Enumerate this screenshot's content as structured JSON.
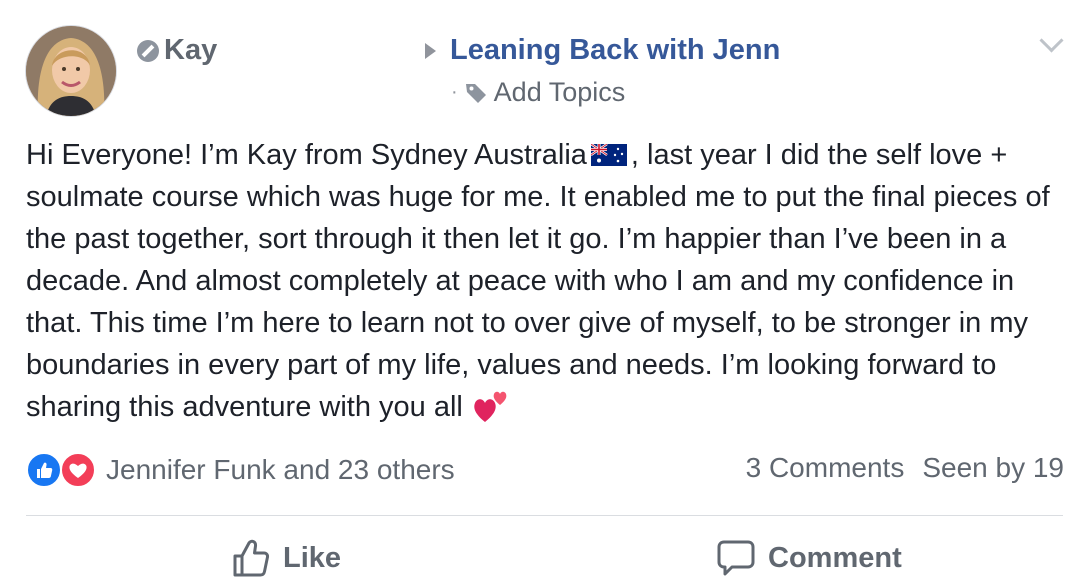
{
  "post": {
    "author": "Kay",
    "group": "Leaning Back with Jenn",
    "topics_label": "Add Topics",
    "text_parts": [
      "Hi Everyone! I’m Kay from Sydney Australia",
      ", last year I did the self love + soulmate course which was huge for me. It enabled me to put the final pieces of the past together, sort through it then let it go. I’m happier than I’ve been in a decade. And almost completely at peace with who I am and my confidence in that. This time I’m here to learn not to over give of myself, to be stronger in my boundaries in every part of my life, values and needs. I’m looking forward to sharing this adventure with you all"
    ]
  },
  "reactions": {
    "summary": "Jennifer Funk and 23 others",
    "icons": [
      "like-icon",
      "love-icon"
    ]
  },
  "stats": {
    "comments": "3 Comments",
    "seen": "Seen by 19"
  },
  "actions": {
    "like_label": "Like",
    "comment_label": "Comment"
  },
  "colors": {
    "link": "#365899",
    "secondary_text": "#606770",
    "like_blue": "#1877f2",
    "love_red": "#f33e58"
  }
}
